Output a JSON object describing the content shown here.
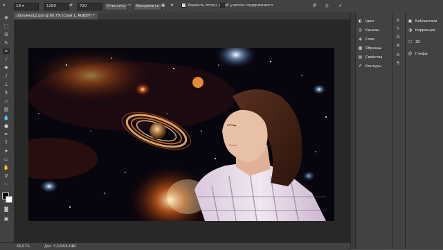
{
  "options": {
    "style_value": "18",
    "width_value": "1280",
    "height_value": "720",
    "clear_label": "Очистить",
    "straighten_label": "Выпрямить",
    "delete_pixels_label": "Удалить отсеч. пикс.",
    "content_aware_label": "С учетом содержимого"
  },
  "document_tab": {
    "label": "обложка12.psd @ 66,7% (Слой 1, RGB/8*) *"
  },
  "status": {
    "zoom": "66,67%",
    "doc_info": "Док: 5,50M/8,64M"
  },
  "panel_group1": {
    "items": [
      {
        "label": "Цвет",
        "icon": "color-wheel-icon"
      },
      {
        "label": "Каналы",
        "icon": "channels-icon"
      },
      {
        "label": "Слои",
        "icon": "layers-icon"
      },
      {
        "label": "Образцы",
        "icon": "swatches-icon"
      },
      {
        "label": "Свойства",
        "icon": "properties-icon"
      },
      {
        "label": "Контуры",
        "icon": "paths-icon"
      }
    ]
  },
  "panel_group2": {
    "items": [
      {
        "label": "Библиотеки",
        "icon": "libraries-icon"
      },
      {
        "label": "Коррекция",
        "icon": "adjustments-icon"
      },
      {
        "label": "3D",
        "icon": "3d-icon"
      },
      {
        "label": "Глифы",
        "icon": "glyphs-icon"
      }
    ]
  },
  "colors": {
    "app_bg": "#535353",
    "toolbar": "#424242",
    "canvas_bg": "#282828"
  }
}
